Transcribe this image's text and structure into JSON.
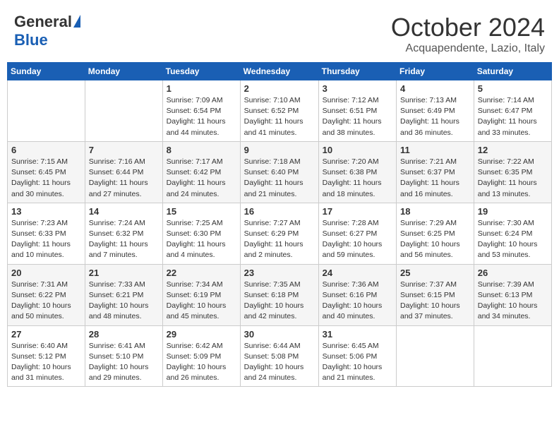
{
  "header": {
    "logo_general": "General",
    "logo_blue": "Blue",
    "month": "October 2024",
    "location": "Acquapendente, Lazio, Italy"
  },
  "calendar": {
    "days_of_week": [
      "Sunday",
      "Monday",
      "Tuesday",
      "Wednesday",
      "Thursday",
      "Friday",
      "Saturday"
    ],
    "weeks": [
      [
        {
          "day": "",
          "info": ""
        },
        {
          "day": "",
          "info": ""
        },
        {
          "day": "1",
          "info": "Sunrise: 7:09 AM\nSunset: 6:54 PM\nDaylight: 11 hours and 44 minutes."
        },
        {
          "day": "2",
          "info": "Sunrise: 7:10 AM\nSunset: 6:52 PM\nDaylight: 11 hours and 41 minutes."
        },
        {
          "day": "3",
          "info": "Sunrise: 7:12 AM\nSunset: 6:51 PM\nDaylight: 11 hours and 38 minutes."
        },
        {
          "day": "4",
          "info": "Sunrise: 7:13 AM\nSunset: 6:49 PM\nDaylight: 11 hours and 36 minutes."
        },
        {
          "day": "5",
          "info": "Sunrise: 7:14 AM\nSunset: 6:47 PM\nDaylight: 11 hours and 33 minutes."
        }
      ],
      [
        {
          "day": "6",
          "info": "Sunrise: 7:15 AM\nSunset: 6:45 PM\nDaylight: 11 hours and 30 minutes."
        },
        {
          "day": "7",
          "info": "Sunrise: 7:16 AM\nSunset: 6:44 PM\nDaylight: 11 hours and 27 minutes."
        },
        {
          "day": "8",
          "info": "Sunrise: 7:17 AM\nSunset: 6:42 PM\nDaylight: 11 hours and 24 minutes."
        },
        {
          "day": "9",
          "info": "Sunrise: 7:18 AM\nSunset: 6:40 PM\nDaylight: 11 hours and 21 minutes."
        },
        {
          "day": "10",
          "info": "Sunrise: 7:20 AM\nSunset: 6:38 PM\nDaylight: 11 hours and 18 minutes."
        },
        {
          "day": "11",
          "info": "Sunrise: 7:21 AM\nSunset: 6:37 PM\nDaylight: 11 hours and 16 minutes."
        },
        {
          "day": "12",
          "info": "Sunrise: 7:22 AM\nSunset: 6:35 PM\nDaylight: 11 hours and 13 minutes."
        }
      ],
      [
        {
          "day": "13",
          "info": "Sunrise: 7:23 AM\nSunset: 6:33 PM\nDaylight: 11 hours and 10 minutes."
        },
        {
          "day": "14",
          "info": "Sunrise: 7:24 AM\nSunset: 6:32 PM\nDaylight: 11 hours and 7 minutes."
        },
        {
          "day": "15",
          "info": "Sunrise: 7:25 AM\nSunset: 6:30 PM\nDaylight: 11 hours and 4 minutes."
        },
        {
          "day": "16",
          "info": "Sunrise: 7:27 AM\nSunset: 6:29 PM\nDaylight: 11 hours and 2 minutes."
        },
        {
          "day": "17",
          "info": "Sunrise: 7:28 AM\nSunset: 6:27 PM\nDaylight: 10 hours and 59 minutes."
        },
        {
          "day": "18",
          "info": "Sunrise: 7:29 AM\nSunset: 6:25 PM\nDaylight: 10 hours and 56 minutes."
        },
        {
          "day": "19",
          "info": "Sunrise: 7:30 AM\nSunset: 6:24 PM\nDaylight: 10 hours and 53 minutes."
        }
      ],
      [
        {
          "day": "20",
          "info": "Sunrise: 7:31 AM\nSunset: 6:22 PM\nDaylight: 10 hours and 50 minutes."
        },
        {
          "day": "21",
          "info": "Sunrise: 7:33 AM\nSunset: 6:21 PM\nDaylight: 10 hours and 48 minutes."
        },
        {
          "day": "22",
          "info": "Sunrise: 7:34 AM\nSunset: 6:19 PM\nDaylight: 10 hours and 45 minutes."
        },
        {
          "day": "23",
          "info": "Sunrise: 7:35 AM\nSunset: 6:18 PM\nDaylight: 10 hours and 42 minutes."
        },
        {
          "day": "24",
          "info": "Sunrise: 7:36 AM\nSunset: 6:16 PM\nDaylight: 10 hours and 40 minutes."
        },
        {
          "day": "25",
          "info": "Sunrise: 7:37 AM\nSunset: 6:15 PM\nDaylight: 10 hours and 37 minutes."
        },
        {
          "day": "26",
          "info": "Sunrise: 7:39 AM\nSunset: 6:13 PM\nDaylight: 10 hours and 34 minutes."
        }
      ],
      [
        {
          "day": "27",
          "info": "Sunrise: 6:40 AM\nSunset: 5:12 PM\nDaylight: 10 hours and 31 minutes."
        },
        {
          "day": "28",
          "info": "Sunrise: 6:41 AM\nSunset: 5:10 PM\nDaylight: 10 hours and 29 minutes."
        },
        {
          "day": "29",
          "info": "Sunrise: 6:42 AM\nSunset: 5:09 PM\nDaylight: 10 hours and 26 minutes."
        },
        {
          "day": "30",
          "info": "Sunrise: 6:44 AM\nSunset: 5:08 PM\nDaylight: 10 hours and 24 minutes."
        },
        {
          "day": "31",
          "info": "Sunrise: 6:45 AM\nSunset: 5:06 PM\nDaylight: 10 hours and 21 minutes."
        },
        {
          "day": "",
          "info": ""
        },
        {
          "day": "",
          "info": ""
        }
      ]
    ]
  }
}
